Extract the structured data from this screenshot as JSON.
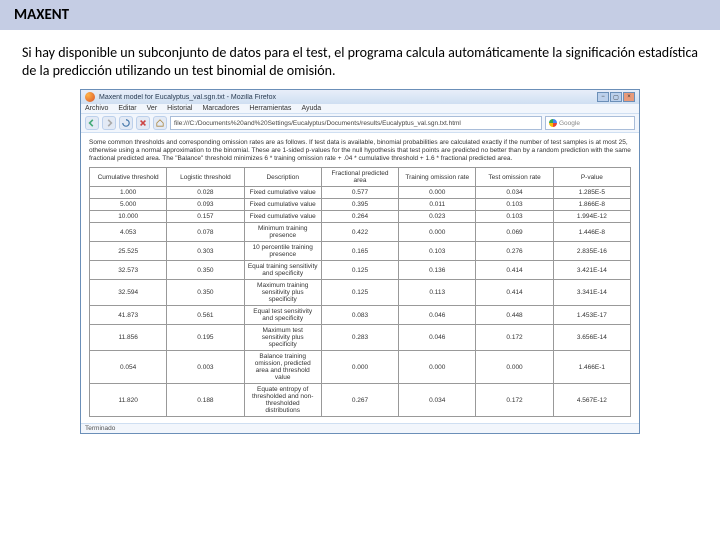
{
  "header": {
    "title": "MAXENT"
  },
  "paragraph": "Si hay disponible un subconjunto de datos para el test, el programa calcula automáticamente la significación estadística de la predicción utilizando un test binomial de omisión.",
  "browser": {
    "title": "Maxent model for Eucalyptus_val.sgn.txt - Mozilla Firefox",
    "menu": [
      "Archivo",
      "Editar",
      "Ver",
      "Historial",
      "Marcadores",
      "Herramientas",
      "Ayuda"
    ],
    "url": "file:///C:/Documents%20and%20Settings/Eucalyptus/Documents/results/Eucalyptus_val.sgn.txt.html",
    "search_placeholder": "Google",
    "status": "Terminado",
    "intro": "Some common thresholds and corresponding omission rates are as follows. If test data is available, binomial probabilities are calculated exactly if the number of test samples is at most 25, otherwise using a normal approximation to the binomial. These are 1-sided p-values for the null hypothesis that test points are predicted no better than by a random prediction with the same fractional predicted area. The \"Balance\" threshold minimizes 6 * training omission rate + .04 * cumulative threshold + 1.6 * fractional predicted area."
  },
  "table": {
    "headers": [
      "Cumulative threshold",
      "Logistic threshold",
      "Description",
      "Fractional predicted area",
      "Training omission rate",
      "Test omission rate",
      "P-value"
    ],
    "rows": [
      [
        "1.000",
        "0.028",
        "Fixed cumulative value",
        "0.577",
        "0.000",
        "0.034",
        "1.285E-5"
      ],
      [
        "5.000",
        "0.093",
        "Fixed cumulative value",
        "0.395",
        "0.011",
        "0.103",
        "1.866E-8"
      ],
      [
        "10.000",
        "0.157",
        "Fixed cumulative value",
        "0.264",
        "0.023",
        "0.103",
        "1.994E-12"
      ],
      [
        "4.053",
        "0.078",
        "Minimum training presence",
        "0.422",
        "0.000",
        "0.069",
        "1.446E-8"
      ],
      [
        "25.525",
        "0.303",
        "10 percentile training presence",
        "0.165",
        "0.103",
        "0.276",
        "2.835E-16"
      ],
      [
        "32.573",
        "0.350",
        "Equal training sensitivity and specificity",
        "0.125",
        "0.136",
        "0.414",
        "3.421E-14"
      ],
      [
        "32.594",
        "0.350",
        "Maximum training sensitivity plus specificity",
        "0.125",
        "0.113",
        "0.414",
        "3.341E-14"
      ],
      [
        "41.873",
        "0.561",
        "Equal test sensitivity and specificity",
        "0.083",
        "0.046",
        "0.448",
        "1.453E-17"
      ],
      [
        "11.856",
        "0.195",
        "Maximum test sensitivity plus specificity",
        "0.283",
        "0.046",
        "0.172",
        "3.656E-14"
      ],
      [
        "0.054",
        "0.003",
        "Balance training omission, predicted area and threshold value",
        "0.000",
        "0.000",
        "0.000",
        "1.466E-1"
      ],
      [
        "11.820",
        "0.188",
        "Equate entropy of thresholded and non-thresholded distributions",
        "0.267",
        "0.034",
        "0.172",
        "4.567E-12"
      ]
    ]
  }
}
